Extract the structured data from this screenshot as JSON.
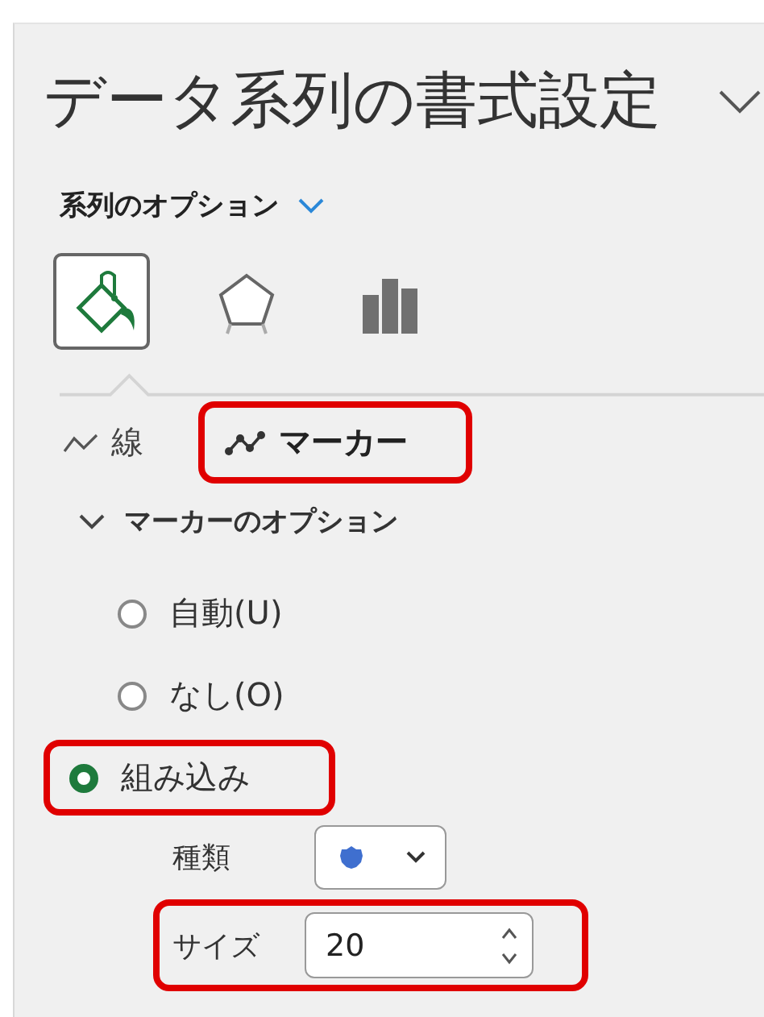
{
  "pane": {
    "title": "データ系列の書式設定"
  },
  "options_menu": {
    "label": "系列のオプション"
  },
  "category_icons": [
    {
      "kind": "fill",
      "selected": true
    },
    {
      "kind": "effects",
      "selected": false
    },
    {
      "kind": "series",
      "selected": false
    }
  ],
  "tabs": [
    {
      "kind": "line",
      "label": "線",
      "selected": false,
      "highlighted": false
    },
    {
      "kind": "marker",
      "label": "マーカー",
      "selected": true,
      "highlighted": true
    }
  ],
  "section": {
    "title": "マーカーのオプション",
    "expanded": true
  },
  "marker_options": [
    {
      "label": "自動(U)",
      "selected": false,
      "highlighted": false
    },
    {
      "label": "なし(O)",
      "selected": false,
      "highlighted": false
    },
    {
      "label": "組み込み",
      "selected": true,
      "highlighted": true
    }
  ],
  "type_field": {
    "label": "種類"
  },
  "size_field": {
    "label": "サイズ",
    "value": "20",
    "highlighted": true
  }
}
